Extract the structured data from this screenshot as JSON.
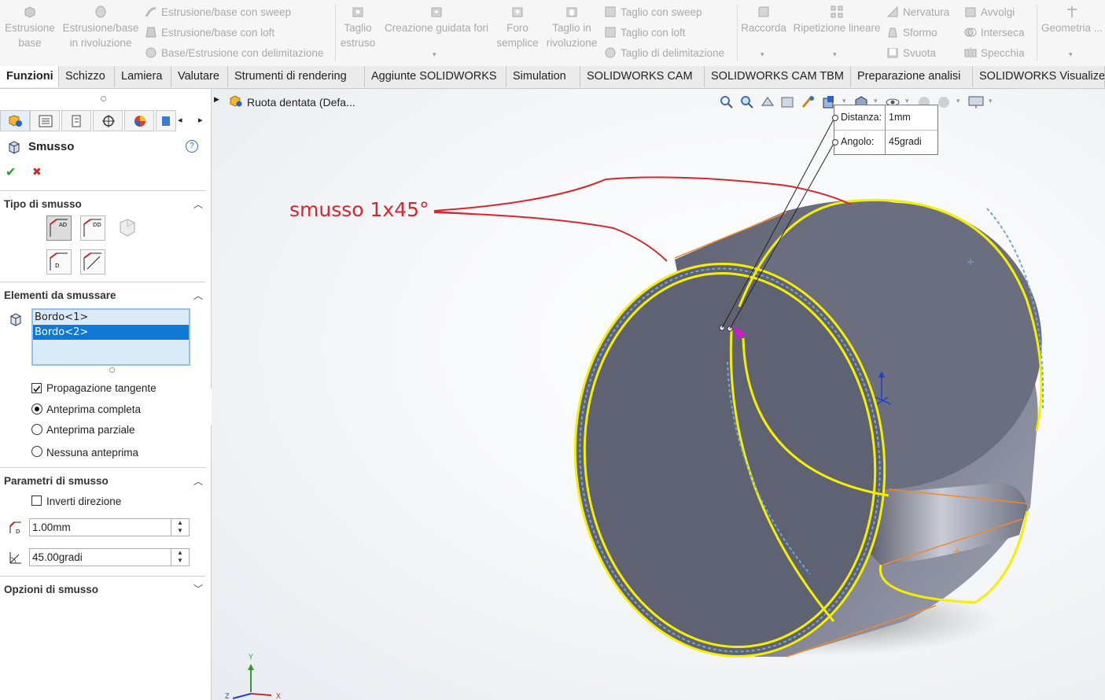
{
  "ribbon": {
    "extrude_boss": "Estrusione\nbase",
    "revolve_boss": "Estrusione/base\nin rivoluzione",
    "swept_boss": "Estrusione/base con sweep",
    "lofted_boss": "Estrusione/base con loft",
    "boundary_boss": "Base/Estrusione con delimitazione",
    "extruded_cut": "Taglio\nestruso",
    "hole_wizard": "Creazione guidata fori",
    "simple_hole": "Foro\nsemplice",
    "revolved_cut": "Taglio in\nrivoluzione",
    "swept_cut": "Taglio con sweep",
    "lofted_cut": "Taglio con loft",
    "boundary_cut": "Taglio di delimitazione",
    "fillet": "Raccorda",
    "linear_pattern": "Ripetizione lineare",
    "rib": "Nervatura",
    "draft": "Sformo",
    "shell": "Svuota",
    "wrap": "Avvolgi",
    "intersect": "Interseca",
    "mirror": "Specchia",
    "geometry": "Geometria ..."
  },
  "tabs": [
    "Funzioni",
    "Schizzo",
    "Lamiera",
    "Valutare",
    "Strumenti di rendering",
    "Aggiunte SOLIDWORKS",
    "Simulation",
    "SOLIDWORKS CAM",
    "SOLIDWORKS CAM TBM",
    "Preparazione analisi",
    "SOLIDWORKS Visualize"
  ],
  "active_tab": "Funzioni",
  "panel": {
    "title": "Smusso",
    "help": "?",
    "ok": "✔",
    "cancel": "✖",
    "section_type": "Tipo di smusso",
    "section_items": "Elementi da smussare",
    "items": [
      "Bordo<1>",
      "Bordo<2>"
    ],
    "selected_item": "Bordo<2>",
    "tangent_propagation": "Propagazione tangente",
    "tangent_propagation_checked": true,
    "preview_full": "Anteprima completa",
    "preview_partial": "Anteprima parziale",
    "preview_none": "Nessuna anteprima",
    "preview_selected": "Anteprima completa",
    "section_params": "Parametri di smusso",
    "reverse_direction": "Inverti direzione",
    "reverse_direction_checked": false,
    "distance": "1.00mm",
    "angle": "45.00gradi",
    "section_options": "Opzioni di smusso"
  },
  "viewport": {
    "tree_item": "Ruota dentata (Defa...",
    "annotation": "smusso 1x45°",
    "annotation_color": "#d9262b",
    "callout": {
      "distance_label": "Distanza:",
      "distance_value": "1mm",
      "angle_label": "Angolo:",
      "angle_value": "45gradi"
    },
    "axes": {
      "y": "Y",
      "z": "Z",
      "x": "X"
    }
  },
  "colors": {
    "edge_highlight": "#f5f000",
    "body_face": "#6c7080",
    "selection_blue": "#0f77d4"
  }
}
